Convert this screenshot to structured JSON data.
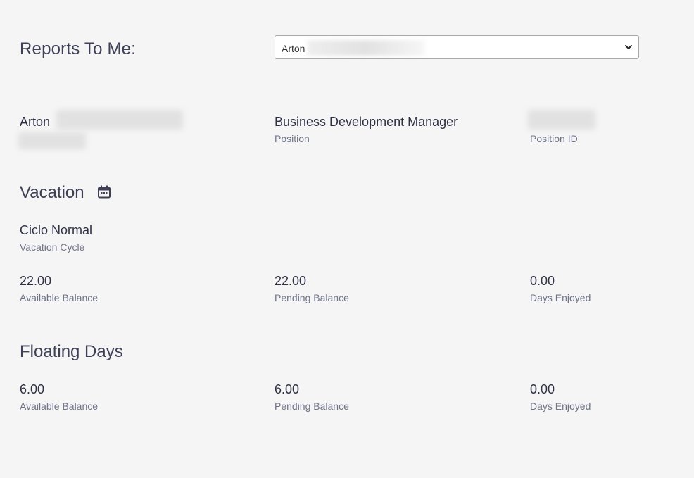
{
  "reports": {
    "label": "Reports To Me:",
    "selected_value": "Arton"
  },
  "employee": {
    "name": "Arton",
    "position_value": "Business Development Manager",
    "position_caption": "Position",
    "position_id_caption": "Position ID"
  },
  "vacation": {
    "title": "Vacation",
    "icon": "calendar-icon",
    "cycle_value": "Ciclo Normal",
    "cycle_caption": "Vacation Cycle",
    "available_value": "22.00",
    "available_caption": "Available Balance",
    "pending_value": "22.00",
    "pending_caption": "Pending Balance",
    "enjoyed_value": "0.00",
    "enjoyed_caption": "Days Enjoyed"
  },
  "floating": {
    "title": "Floating Days",
    "available_value": "6.00",
    "available_caption": "Available Balance",
    "pending_value": "6.00",
    "pending_caption": "Pending Balance",
    "enjoyed_value": "0.00",
    "enjoyed_caption": "Days Enjoyed"
  }
}
